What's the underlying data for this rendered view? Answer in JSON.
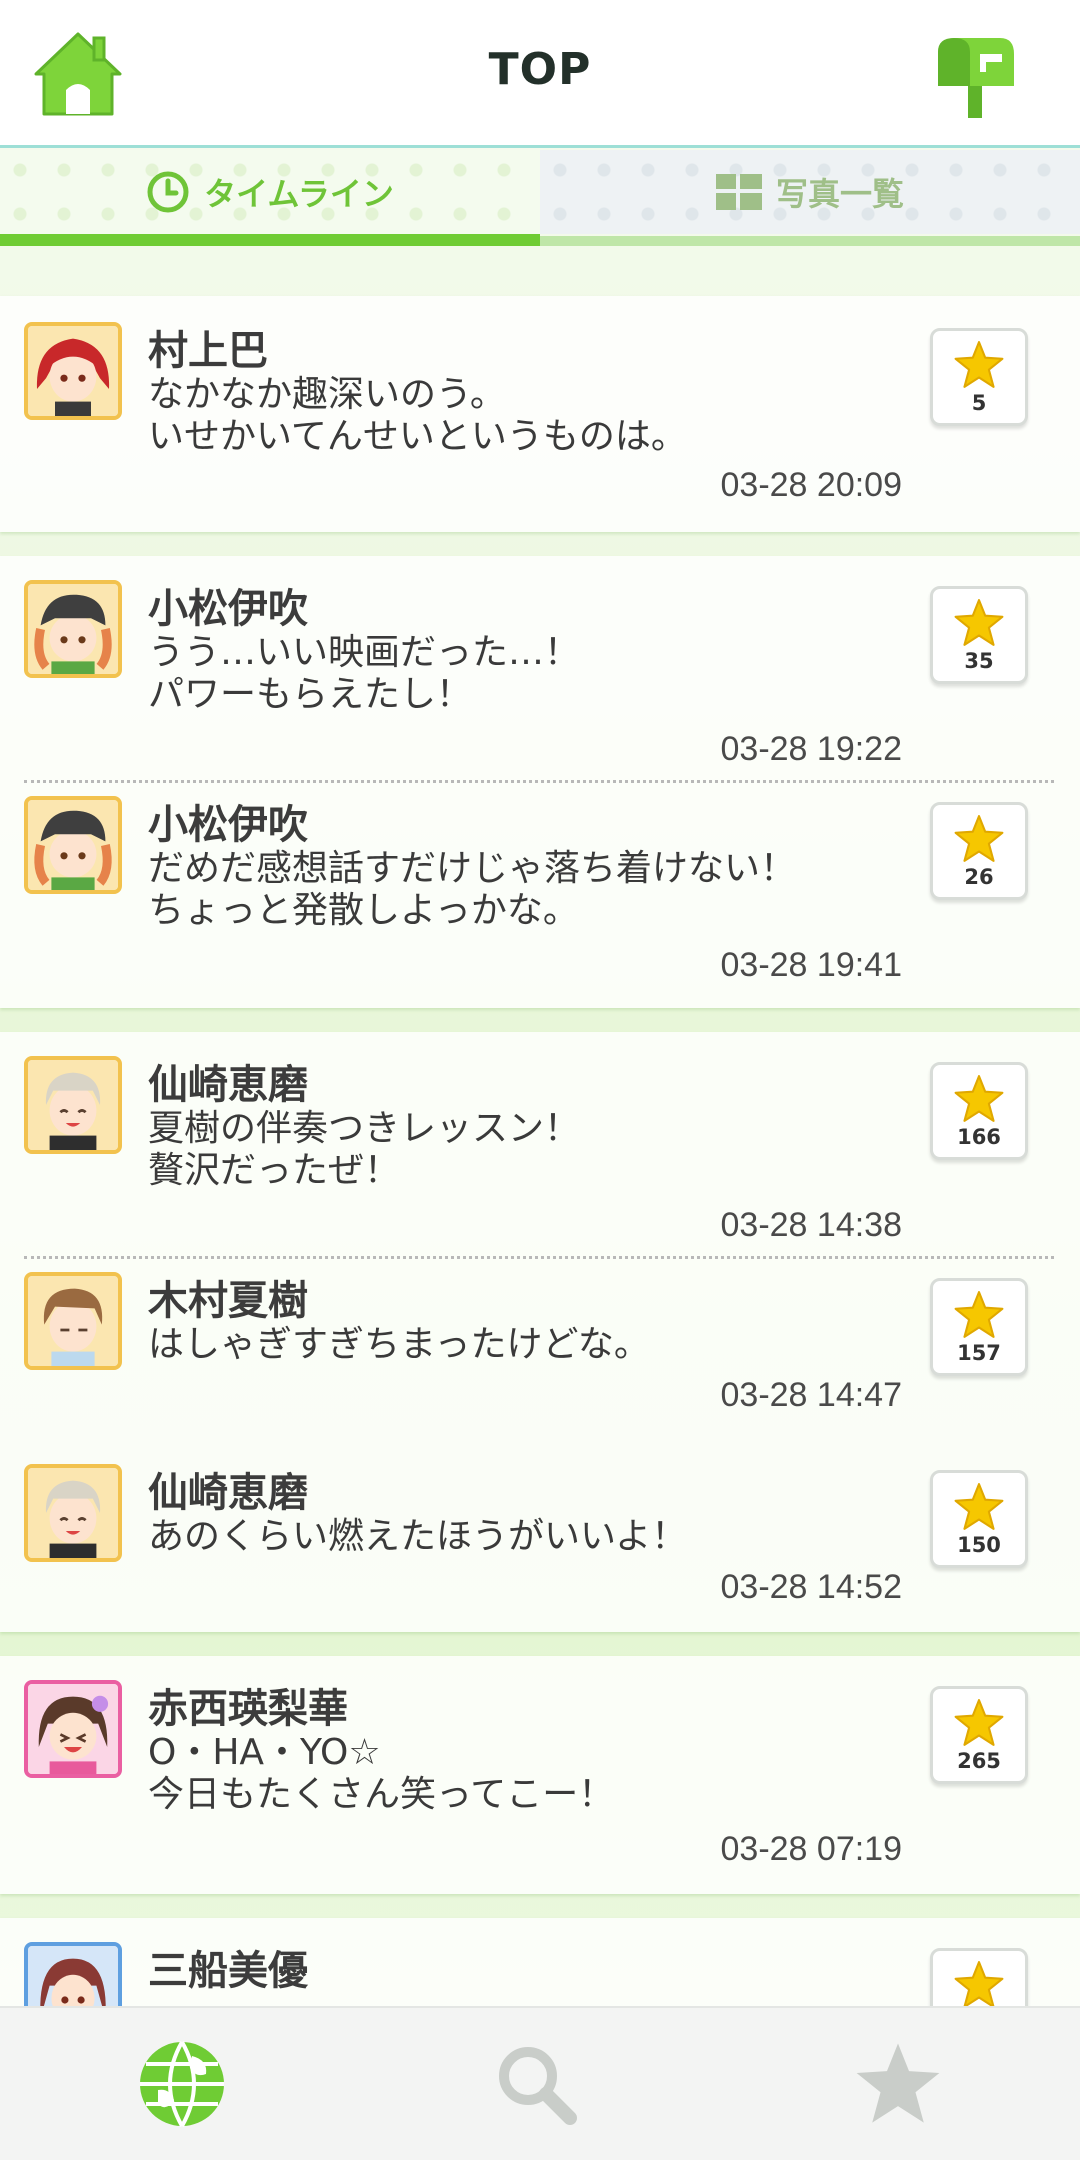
{
  "header": {
    "title": "TOP",
    "home_icon": "home-icon",
    "mail_icon": "mailbox-icon"
  },
  "tabs": [
    {
      "label": "タイムライン",
      "icon": "clock-icon",
      "active": true
    },
    {
      "label": "写真一覧",
      "icon": "grid-icon",
      "active": false
    }
  ],
  "posts": [
    {
      "name": "村上巴",
      "message": "なかなか趣深いのう。\nいせかいてんせいというものは。",
      "time": "03-28 20:09",
      "stars": "5"
    },
    {
      "name": "小松伊吹",
      "message": "うう…いい映画だった…！\nパワーもらえたし！",
      "time": "03-28 19:22",
      "stars": "35"
    },
    {
      "name": "小松伊吹",
      "message": "だめだ感想話すだけじゃ落ち着けない！\nちょっと発散しよっかな。",
      "time": "03-28 19:41",
      "stars": "26"
    },
    {
      "name": "仙崎恵磨",
      "message": "夏樹の伴奏つきレッスン！\n贅沢だったぜ！",
      "time": "03-28 14:38",
      "stars": "166"
    },
    {
      "name": "木村夏樹",
      "message": "はしゃぎすぎちまったけどな。",
      "time": "03-28 14:47",
      "stars": "157"
    },
    {
      "name": "仙崎恵磨",
      "message": "あのくらい燃えたほうがいいよ！",
      "time": "03-28 14:52",
      "stars": "150"
    },
    {
      "name": "赤西瑛梨華",
      "message": "O・HA・YO☆\n今日もたくさん笑ってこー！",
      "time": "03-28 07:19",
      "stars": "265"
    },
    {
      "name": "三船美優",
      "message": "",
      "time": "",
      "stars": ""
    }
  ],
  "bottom_nav": [
    {
      "icon": "globe-icon",
      "active": true
    },
    {
      "icon": "search-icon",
      "active": false
    },
    {
      "icon": "star-icon",
      "active": false
    }
  ],
  "colors": {
    "accent": "#6fcc34",
    "avatar_gold": "#f2c24e",
    "avatar_pink": "#ea5fa2",
    "avatar_blue": "#5e9fe0",
    "star": "#f6c700"
  }
}
